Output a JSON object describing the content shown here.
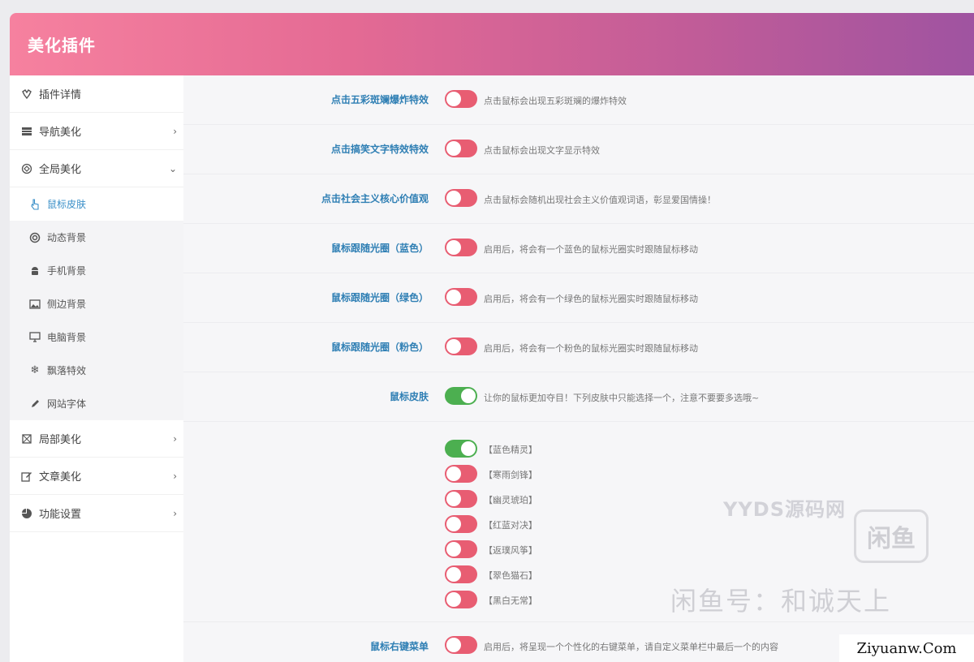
{
  "header": {
    "title": "美化插件"
  },
  "sidebar": {
    "items": [
      {
        "label": "插件详情",
        "icon": "puzzle-icon",
        "chevron": ""
      },
      {
        "label": "导航美化",
        "icon": "navbar-icon",
        "chevron": "›"
      },
      {
        "label": "全局美化",
        "icon": "globe-icon",
        "chevron": "⌄"
      }
    ],
    "submenu": [
      {
        "label": "鼠标皮肤",
        "icon": "pointer-icon"
      },
      {
        "label": "动态背景",
        "icon": "lifebuoy-icon"
      },
      {
        "label": "手机背景",
        "icon": "android-icon"
      },
      {
        "label": "侧边背景",
        "icon": "image-icon"
      },
      {
        "label": "电脑背景",
        "icon": "monitor-icon"
      },
      {
        "label": "飘落特效",
        "icon": "snowflake-icon"
      },
      {
        "label": "网站字体",
        "icon": "pen-icon"
      }
    ],
    "items_after": [
      {
        "label": "局部美化",
        "icon": "crop-icon",
        "chevron": "›"
      },
      {
        "label": "文章美化",
        "icon": "edit-icon",
        "chevron": "›"
      },
      {
        "label": "功能设置",
        "icon": "pie-chart-icon",
        "chevron": "›"
      }
    ]
  },
  "settings": [
    {
      "label": "点击五彩斑斓爆炸特效",
      "desc": "点击鼠标会出现五彩斑斓的爆炸特效",
      "on": false
    },
    {
      "label": "点击搞笑文字特效特效",
      "desc": "点击鼠标会出现文字显示特效",
      "on": false
    },
    {
      "label": "点击社会主义核心价值观",
      "desc": "点击鼠标会随机出现社会主义价值观词语，彰显爱国情操！",
      "on": false
    },
    {
      "label": "鼠标跟随光圈（蓝色）",
      "desc": "启用后，将会有一个蓝色的鼠标光圈实时跟随鼠标移动",
      "on": false
    },
    {
      "label": "鼠标跟随光圈（绿色）",
      "desc": "启用后，将会有一个绿色的鼠标光圈实时跟随鼠标移动",
      "on": false
    },
    {
      "label": "鼠标跟随光圈（粉色）",
      "desc": "启用后，将会有一个粉色的鼠标光圈实时跟随鼠标移动",
      "on": false
    },
    {
      "label": "鼠标皮肤",
      "desc": "让你的鼠标更加夺目！下列皮肤中只能选择一个，注意不要要多选哦~",
      "on": true
    }
  ],
  "skins": [
    {
      "label": "【蓝色精灵】",
      "on": true
    },
    {
      "label": "【寒雨剑锋】",
      "on": false
    },
    {
      "label": "【幽灵琥珀】",
      "on": false
    },
    {
      "label": "【红蓝对决】",
      "on": false
    },
    {
      "label": "【返璞风筝】",
      "on": false
    },
    {
      "label": "【翠色猫石】",
      "on": false
    },
    {
      "label": "【黑白无常】",
      "on": false
    }
  ],
  "right_menu": {
    "label": "鼠标右键菜单",
    "desc": "启用后，将呈现一个个性化的右键菜单，请自定义菜单栏中最后一个的内容",
    "on": false
  },
  "watermarks": {
    "yyds": "YYDS源码网",
    "xianyu": "闲鱼",
    "line": "闲鱼号：和诚天上",
    "site": "Ziyuanw.Com"
  },
  "colors": {
    "toggle_on": "#4caf50",
    "toggle_off": "#e85d72",
    "label": "#2f7fb4",
    "active_nav": "#3a8fc8"
  }
}
